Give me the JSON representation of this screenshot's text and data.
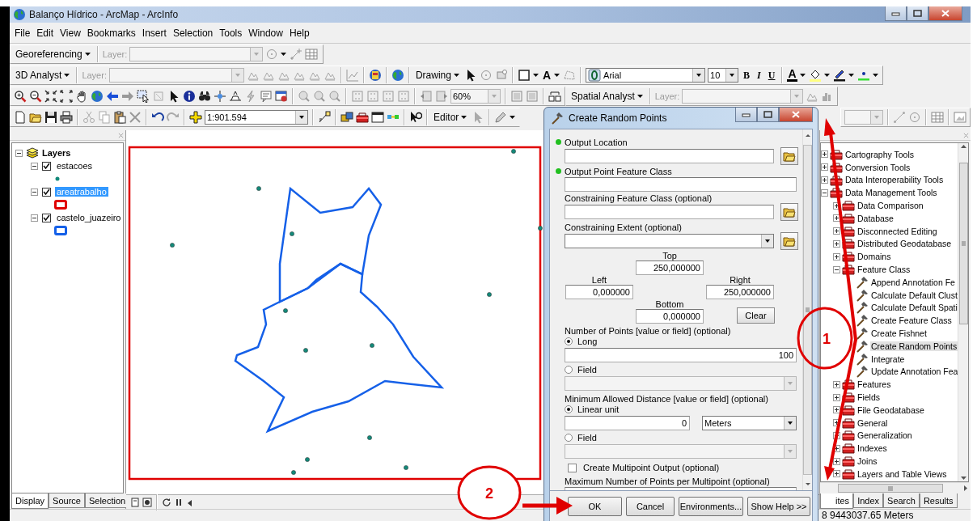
{
  "window": {
    "title": "Balanço Hídrico - ArcMap - ArcInfo"
  },
  "menu": [
    {
      "label": "File"
    },
    {
      "label": "Edit"
    },
    {
      "label": "View"
    },
    {
      "label": "Bookmarks"
    },
    {
      "label": "Insert"
    },
    {
      "label": "Selection"
    },
    {
      "label": "Tools"
    },
    {
      "label": "Window"
    },
    {
      "label": "Help"
    }
  ],
  "toolbars": {
    "georeferencing": {
      "label": "Georeferencing",
      "layer_label": "Layer:"
    },
    "analyst_3d": {
      "label": "3D Analyst",
      "layer_label": "Layer:"
    },
    "drawing": {
      "label": "Drawing",
      "text_tool": "A",
      "font": "Arial",
      "font_size": "10",
      "bold": "B",
      "italic": "I",
      "underline": "U",
      "font_color": "A"
    },
    "tools": {
      "zoom": "60%"
    },
    "spatial_analyst": {
      "label": "Spatial Analyst",
      "layer_label": "Layer:"
    },
    "standard": {
      "scale": "1:901.594"
    },
    "editor": {
      "label": "Editor"
    }
  },
  "toc": {
    "root": {
      "label": "Layers",
      "expanded": true,
      "layers": [
        {
          "name": "estacoes",
          "checked": true,
          "expanded": true,
          "selected": false,
          "kind": "point",
          "color": "#138a7a"
        },
        {
          "name": "areatrabalho",
          "checked": true,
          "expanded": true,
          "selected": true,
          "kind": "polygon",
          "color": "#e00000"
        },
        {
          "name": "castelo_juazeiro",
          "checked": true,
          "expanded": true,
          "selected": false,
          "kind": "polygon",
          "color": "#1560e8"
        }
      ]
    },
    "tabs": [
      {
        "label": "Display",
        "selected": true
      },
      {
        "label": "Source",
        "selected": false
      },
      {
        "label": "Selection",
        "selected": false
      }
    ]
  },
  "dialog": {
    "title": "Create Random Points",
    "params": [
      {
        "kind": "text",
        "label": "Output Location",
        "required": true,
        "browse": true
      },
      {
        "kind": "text",
        "label": "Output Point Feature Class",
        "required": true,
        "browse": false
      },
      {
        "kind": "text",
        "label": "Constraining Feature Class (optional)",
        "required": false,
        "browse": true
      },
      {
        "kind": "combo",
        "label": "Constraining Extent (optional)",
        "required": false,
        "browse": true
      },
      {
        "kind": "extent",
        "top": {
          "label": "Top",
          "value": "250,000000"
        },
        "left": {
          "label": "Left",
          "value": "0,000000"
        },
        "right": {
          "label": "Right",
          "value": "250,000000"
        },
        "bottom": {
          "label": "Bottom",
          "value": "0,000000"
        },
        "clear": "Clear"
      },
      {
        "kind": "choice",
        "label": "Number of Points [value or field] (optional)",
        "options": [
          {
            "label": "Long",
            "selected": true,
            "value": "100"
          },
          {
            "label": "Field",
            "selected": false
          }
        ]
      },
      {
        "kind": "choice",
        "label": "Minimum Allowed Distance [value or field] (optional)",
        "options": [
          {
            "label": "Linear unit",
            "selected": true,
            "value": "0",
            "unit": "Meters"
          },
          {
            "label": "Field",
            "selected": false
          }
        ]
      },
      {
        "kind": "check",
        "label": "Create Multipoint Output (optional)",
        "checked": false
      },
      {
        "kind": "text",
        "label": "Maximum Number of Points per Multipoint (optional)",
        "required": false,
        "browse": false
      }
    ],
    "buttons": [
      {
        "label": "OK"
      },
      {
        "label": "Cancel"
      },
      {
        "label": "Environments..."
      },
      {
        "label": "Show Help >>"
      }
    ]
  },
  "toolbox": {
    "items": [
      {
        "label": "Cartography Tools",
        "kind": "toolbox",
        "expanded": false,
        "selected": false
      },
      {
        "label": "Conversion Tools",
        "kind": "toolbox",
        "expanded": false,
        "selected": false
      },
      {
        "label": "Data Interoperability Tools",
        "kind": "toolbox",
        "expanded": false,
        "selected": false
      },
      {
        "label": "Data Management Tools",
        "kind": "toolbox",
        "expanded": true,
        "selected": false,
        "children": [
          {
            "label": "Data Comparison",
            "kind": "toolset",
            "expanded": false,
            "selected": false
          },
          {
            "label": "Database",
            "kind": "toolset",
            "expanded": false,
            "selected": false
          },
          {
            "label": "Disconnected Editing",
            "kind": "toolset",
            "expanded": false,
            "selected": false
          },
          {
            "label": "Distributed Geodatabase",
            "kind": "toolset",
            "expanded": false,
            "selected": false
          },
          {
            "label": "Domains",
            "kind": "toolset",
            "expanded": false,
            "selected": false
          },
          {
            "label": "Feature Class",
            "kind": "toolset",
            "expanded": true,
            "selected": false,
            "children": [
              {
                "label": "Append Annotation Fe",
                "kind": "tool",
                "selected": false
              },
              {
                "label": "Calculate Default Clust",
                "kind": "tool",
                "selected": false
              },
              {
                "label": "Calculate Default Spati",
                "kind": "tool",
                "selected": false
              },
              {
                "label": "Create Feature Class",
                "kind": "tool",
                "selected": false
              },
              {
                "label": "Create Fishnet",
                "kind": "tool",
                "selected": false
              },
              {
                "label": "Create Random Points",
                "kind": "tool",
                "selected": true
              },
              {
                "label": "Integrate",
                "kind": "tool",
                "selected": false
              },
              {
                "label": "Update Annotation Fea",
                "kind": "tool",
                "selected": false
              }
            ]
          },
          {
            "label": "Features",
            "kind": "toolset",
            "expanded": false,
            "selected": false
          },
          {
            "label": "Fields",
            "kind": "toolset",
            "expanded": false,
            "selected": false
          },
          {
            "label": "File Geodatabase",
            "kind": "toolset",
            "expanded": false,
            "selected": false
          },
          {
            "label": "General",
            "kind": "toolset",
            "expanded": false,
            "selected": false
          },
          {
            "label": "Generalization",
            "kind": "toolset",
            "expanded": false,
            "selected": false
          },
          {
            "label": "Indexes",
            "kind": "toolset",
            "expanded": false,
            "selected": false
          },
          {
            "label": "Joins",
            "kind": "toolset",
            "expanded": false,
            "selected": false
          },
          {
            "label": "Layers and Table Views",
            "kind": "toolset",
            "expanded": false,
            "selected": false
          }
        ]
      }
    ],
    "tabs": [
      {
        "label": "ites",
        "selected": true
      },
      {
        "label": "Index",
        "selected": false
      },
      {
        "label": "Search",
        "selected": false
      },
      {
        "label": "Results",
        "selected": false
      }
    ]
  },
  "status_bar": {
    "text": "8 9443037.65 Meters"
  },
  "annotations": [
    {
      "label": "1"
    },
    {
      "label": "2"
    }
  ]
}
